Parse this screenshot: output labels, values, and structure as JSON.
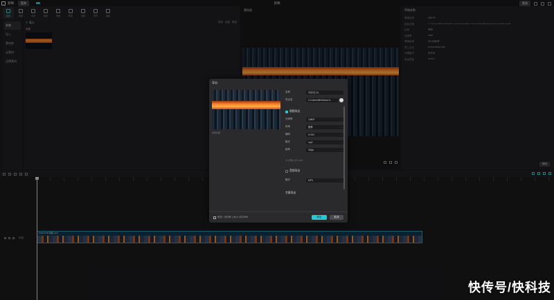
{
  "titlebar": {
    "app_name": "剪映",
    "menu_label": "菜单",
    "project_title": "剪映",
    "login_label": "登录"
  },
  "toolbar": {
    "tools": [
      "媒体",
      "音频",
      "文本",
      "贴纸",
      "特效",
      "转场",
      "滤镜",
      "调节",
      "模板"
    ]
  },
  "sidebar": {
    "items": [
      "本地",
      "导入",
      "素材库",
      "云素材",
      "品牌素材"
    ]
  },
  "media": {
    "import_label": "导入",
    "filter_all": "全部",
    "sort_labels": [
      "排序",
      "全部",
      "筛选"
    ]
  },
  "player": {
    "title": "播放器"
  },
  "details": {
    "title": "草稿参数",
    "rows": [
      {
        "k": "草稿名称",
        "v": "0月0日"
      },
      {
        "k": "保存位置",
        "v": "C:/Users/Mi/AppData/Local/JianyingPro/User Data/Projects/com.lveditor.draft"
      },
      {
        "k": "比例",
        "v": "原始"
      },
      {
        "k": "分辨率",
        "v": "适配"
      },
      {
        "k": "草稿帧率",
        "v": "30.00帧/秒"
      },
      {
        "k": "导入方式",
        "v": "保留在原有位置"
      },
      {
        "k": "代理模式",
        "v": "未开启"
      },
      {
        "k": "自由层级",
        "v": "已开启"
      }
    ],
    "modify_label": "修改"
  },
  "timeline": {
    "clip_label": "0.00 01:02 视频.mp4",
    "track_label": "封面"
  },
  "dialog": {
    "title": "导出",
    "preview_caption": "编辑封面",
    "name_label": "名称",
    "name_value": "0月0日 (1)",
    "export_to_label": "导出至",
    "export_to_value": "C:/Users/Mi/Videos/Ji...",
    "video_section": "视频导出",
    "fields": [
      {
        "label": "分辨率",
        "value": "1080P"
      },
      {
        "label": "码率",
        "value": "推荐"
      },
      {
        "label": "编码",
        "value": "H.264"
      },
      {
        "label": "格式",
        "value": "mp4"
      },
      {
        "label": "帧率",
        "value": "30fps"
      }
    ],
    "note": "大小预估: 约 120M",
    "audio_section": "音频导出",
    "audio_format_label": "格式",
    "audio_format_value": "MP3",
    "subtitle_label": "字幕导出",
    "info_text": "时长: 1分2秒 | 大小: 约120M",
    "export_button": "导出",
    "cancel_button": "取消"
  },
  "watermark": {
    "text": "快传号/快科技"
  },
  "colors": {
    "accent": "#2ec5d2",
    "bg": "#1a1a1c",
    "panel": "#1e1e21"
  }
}
